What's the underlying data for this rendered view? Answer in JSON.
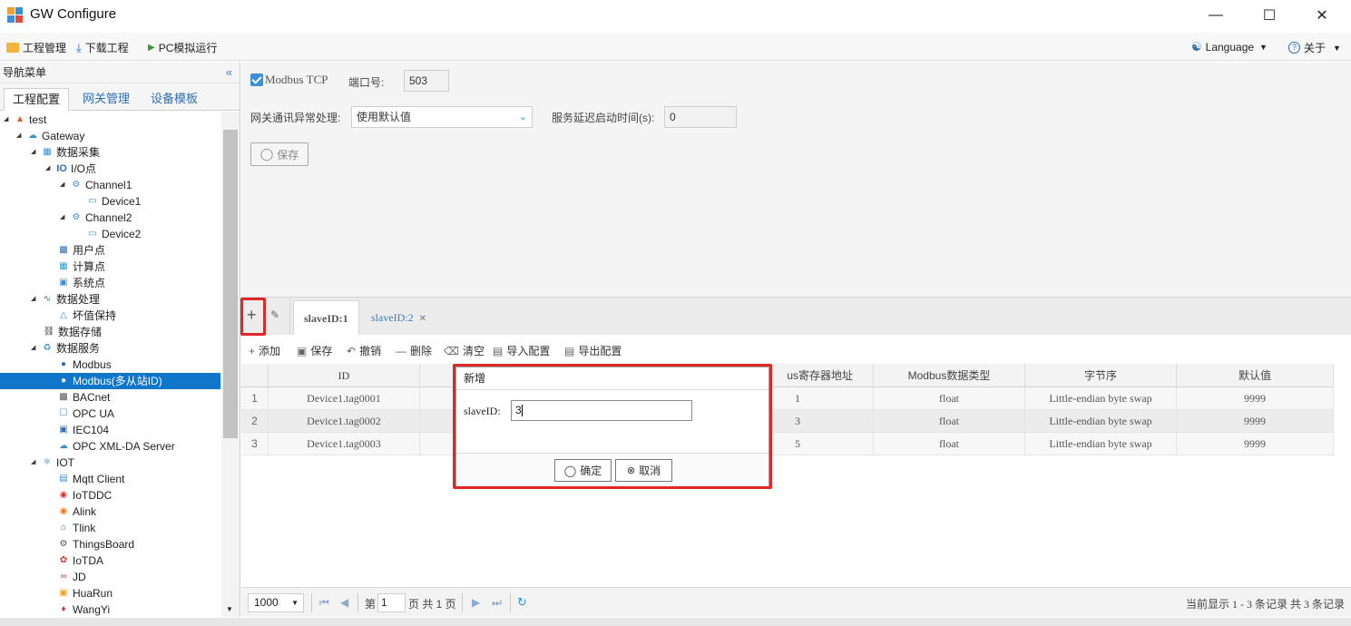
{
  "window": {
    "title": "GW Configure"
  },
  "menubar": {
    "project": "工程管理",
    "download": "下载工程",
    "simulate": "PC模拟运行",
    "language": "Language",
    "about": "关于"
  },
  "nav": {
    "header": "导航菜单",
    "tabs": [
      "工程配置",
      "网关管理",
      "设备模板"
    ],
    "tree": [
      {
        "label": "test",
        "icon": "project-icon"
      },
      {
        "label": "Gateway",
        "icon": "gateway-icon"
      },
      {
        "label": "数据采集",
        "icon": "data-collect-icon"
      },
      {
        "label": "I/O点",
        "icon": "io-icon"
      },
      {
        "label": "Channel1",
        "icon": "channel-icon"
      },
      {
        "label": "Device1",
        "icon": "device-icon"
      },
      {
        "label": "Channel2",
        "icon": "channel-icon"
      },
      {
        "label": "Device2",
        "icon": "device-icon"
      },
      {
        "label": "用户点",
        "icon": "user-point-icon"
      },
      {
        "label": "计算点",
        "icon": "calc-point-icon"
      },
      {
        "label": "系统点",
        "icon": "system-point-icon"
      },
      {
        "label": "数据处理",
        "icon": "data-process-icon"
      },
      {
        "label": "坏值保持",
        "icon": "bad-value-icon"
      },
      {
        "label": "数据存储",
        "icon": "storage-icon"
      },
      {
        "label": "数据服务",
        "icon": "data-service-icon"
      },
      {
        "label": "Modbus",
        "icon": "modbus-icon"
      },
      {
        "label": "Modbus(多从站ID)",
        "icon": "modbus-multi-icon"
      },
      {
        "label": "BACnet",
        "icon": "bacnet-icon"
      },
      {
        "label": "OPC UA",
        "icon": "opcua-icon"
      },
      {
        "label": "IEC104",
        "icon": "iec104-icon"
      },
      {
        "label": "OPC XML-DA Server",
        "icon": "opc-xml-icon"
      },
      {
        "label": "IOT",
        "icon": "iot-icon"
      },
      {
        "label": "Mqtt Client",
        "icon": "mqtt-icon"
      },
      {
        "label": "IoTDDC",
        "icon": "iotddc-icon"
      },
      {
        "label": "Alink",
        "icon": "alink-icon"
      },
      {
        "label": "Tlink",
        "icon": "tlink-icon"
      },
      {
        "label": "ThingsBoard",
        "icon": "thingsboard-icon"
      },
      {
        "label": "IoTDA",
        "icon": "iotda-icon"
      },
      {
        "label": "JD",
        "icon": "jd-icon"
      },
      {
        "label": "HuaRun",
        "icon": "huarun-icon"
      },
      {
        "label": "WangYi",
        "icon": "wangyi-icon"
      }
    ]
  },
  "config": {
    "modbus_tcp_label": "Modbus TCP",
    "port_label": "端口号:",
    "port_value": "503",
    "exception_label": "网关通讯异常处理:",
    "exception_value": "使用默认值",
    "delay_label": "服务延迟启动时间(s):",
    "delay_value": "0",
    "save_label": "保存"
  },
  "slave_tabs": [
    "slaveID:1",
    "slaveID:2"
  ],
  "toolbar": {
    "add": "添加",
    "save": "保存",
    "undo": "撤销",
    "delete": "删除",
    "clear": "清空",
    "import": "导入配置",
    "export": "导出配置"
  },
  "grid": {
    "columns": [
      "ID",
      "",
      "",
      "us寄存器地址",
      "Modbus数据类型",
      "字节序",
      "默认值"
    ],
    "rows": [
      {
        "n": "1",
        "id": "Device1.tag0001",
        "addr": "1",
        "type": "float",
        "order": "Little-endian byte swap",
        "def": "9999"
      },
      {
        "n": "2",
        "id": "Device1.tag0002",
        "addr": "3",
        "type": "float",
        "order": "Little-endian byte swap",
        "def": "9999"
      },
      {
        "n": "3",
        "id": "Device1.tag0003",
        "addr": "5",
        "type": "float",
        "order": "Little-endian byte swap",
        "def": "9999"
      }
    ]
  },
  "pager": {
    "page_size": "1000",
    "page_prefix": "第",
    "page_value": "1",
    "page_suffix": "页 共 1 页",
    "summary": "当前显示 1 - 3 条记录 共 3 条记录"
  },
  "dialog": {
    "title": "新增",
    "field_label": "slaveID:",
    "field_value": "3",
    "ok": "确定",
    "cancel": "取消"
  },
  "colors": {
    "accent": "#1076c9",
    "highlight": "#e32626"
  }
}
